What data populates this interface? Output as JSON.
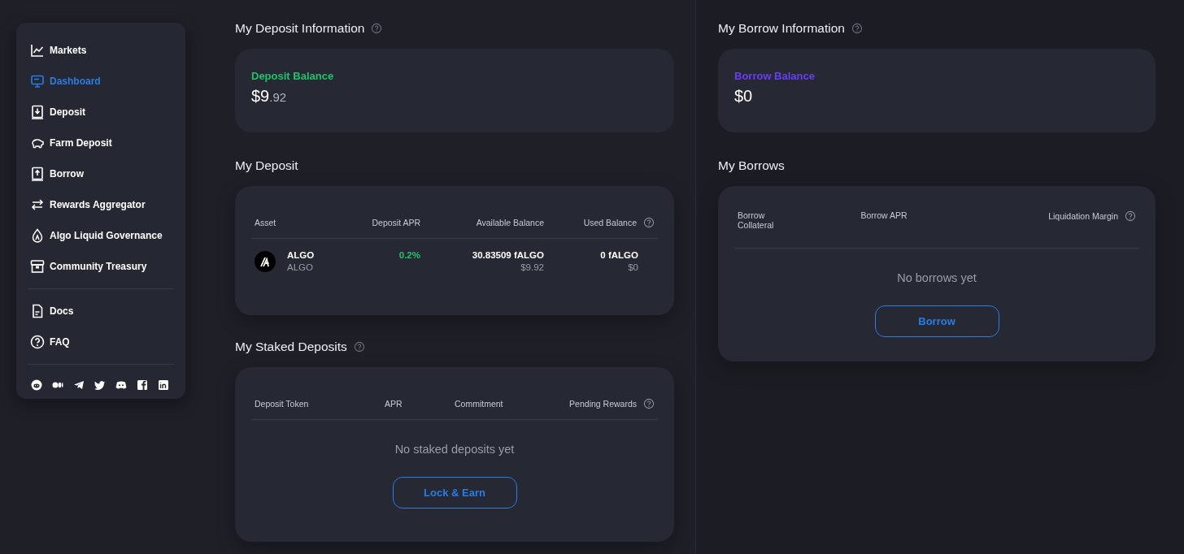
{
  "sidebar": {
    "nav_items": [
      {
        "label": "Markets",
        "selected": false
      },
      {
        "label": "Dashboard",
        "selected": true
      },
      {
        "label": "Deposit",
        "selected": false
      },
      {
        "label": "Farm Deposit",
        "selected": false
      },
      {
        "label": "Borrow",
        "selected": false
      },
      {
        "label": "Rewards Aggregator",
        "selected": false
      },
      {
        "label": "Algo Liquid Governance",
        "selected": false
      },
      {
        "label": "Community Treasury",
        "selected": false
      }
    ],
    "secondary_items": [
      {
        "label": "Docs",
        "selected": false
      },
      {
        "label": "FAQ",
        "selected": false
      }
    ]
  },
  "deposit_information": {
    "title": "My Deposit Information",
    "help": true,
    "kind": "deposit",
    "balance_label": "Deposit Balance",
    "balance_whole": "$9",
    "balance_decimals": ".92"
  },
  "my_deposit": {
    "title": "My Deposit",
    "help": false,
    "columns": [
      {
        "label": "Asset",
        "help": false
      },
      {
        "label": "Deposit APR",
        "help": false
      },
      {
        "label": "Available Balance",
        "help": false
      },
      {
        "label": "Used Balance",
        "help": true
      }
    ],
    "rows": [
      {
        "asset": "ALGO",
        "asset_sub": "ALGO",
        "apr": "0.2%",
        "available": "30.83509 fALGO",
        "available_usd": "$9.92",
        "used": "0 fALGO",
        "used_usd": "$0"
      }
    ]
  },
  "staked_deposits": {
    "title": "My Staked Deposits",
    "help": true,
    "kind": "staked",
    "columns": [
      {
        "label": "Deposit Token",
        "help": false
      },
      {
        "label": "APR",
        "help": false
      },
      {
        "label": "Commitment",
        "help": false
      },
      {
        "label": "Pending Rewards",
        "help": true
      }
    ],
    "empty_text": "No staked deposits yet",
    "button": "Lock & Earn"
  },
  "borrow_information": {
    "title": "My Borrow Information",
    "help": true,
    "kind": "borrow",
    "balance_label": "Borrow Balance",
    "balance_whole": "$0"
  },
  "my_borrows": {
    "title": "My Borrows",
    "help": false,
    "kind": "borrows",
    "columns": [
      {
        "label": "Borrow Collateral",
        "help": false
      },
      {
        "label": "Borrow APR",
        "help": false
      },
      {
        "label": "Liquidation Margin",
        "help": true
      }
    ],
    "empty_text": "No borrows yet",
    "button": "Borrow"
  }
}
